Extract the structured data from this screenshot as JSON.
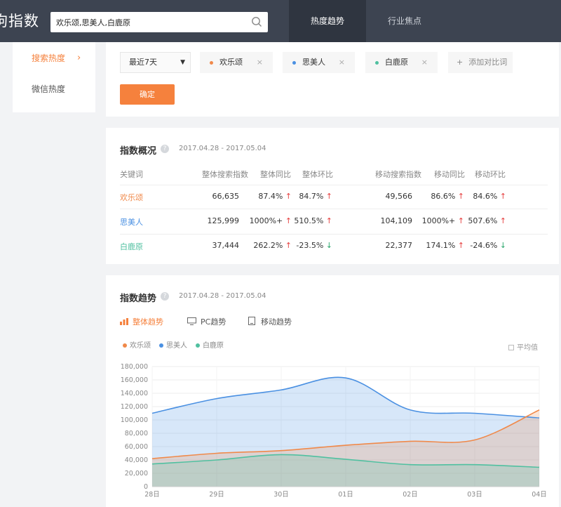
{
  "header": {
    "logo": "狗指数",
    "search_value": "欢乐颂,思美人,白鹿原",
    "tabs": [
      {
        "label": "热度趋势",
        "active": true
      },
      {
        "label": "行业焦点",
        "active": false
      }
    ]
  },
  "sidebar": {
    "items": [
      {
        "label": "搜索热度",
        "active": true
      },
      {
        "label": "微信热度",
        "active": false
      }
    ]
  },
  "filter": {
    "period": "最近7天",
    "keywords": [
      {
        "label": "欢乐颂",
        "color": "#f0894a"
      },
      {
        "label": "思美人",
        "color": "#4a90e2"
      },
      {
        "label": "白鹿原",
        "color": "#50c0a0"
      }
    ],
    "close_glyph": "×",
    "add_label": "添加对比词",
    "confirm_label": "确定"
  },
  "overview": {
    "title": "指数概况",
    "date_range": "2017.04.28 - 2017.05.04",
    "headers": [
      "关键词",
      "整体搜索指数",
      "整体同比",
      "整体环比",
      "移动搜索指数",
      "移动同比",
      "移动环比"
    ],
    "rows": [
      {
        "keyword": "欢乐颂",
        "color": "#f0894a",
        "total": "66,635",
        "yoy": "87.4%",
        "yoy_dir": "up",
        "mom": "84.7%",
        "mom_dir": "up",
        "mobile": "49,566",
        "m_yoy": "86.6%",
        "m_yoy_dir": "up",
        "m_mom": "84.6%",
        "m_mom_dir": "up"
      },
      {
        "keyword": "思美人",
        "color": "#4a90e2",
        "total": "125,999",
        "yoy": "1000%+",
        "yoy_dir": "up",
        "mom": "510.5%",
        "mom_dir": "up",
        "mobile": "104,109",
        "m_yoy": "1000%+",
        "m_yoy_dir": "up",
        "m_mom": "507.6%",
        "m_mom_dir": "up"
      },
      {
        "keyword": "白鹿原",
        "color": "#50c0a0",
        "total": "37,444",
        "yoy": "262.2%",
        "yoy_dir": "up",
        "mom": "-23.5%",
        "mom_dir": "down",
        "mobile": "22,377",
        "m_yoy": "174.1%",
        "m_yoy_dir": "up",
        "m_mom": "-24.6%",
        "m_mom_dir": "down"
      }
    ]
  },
  "trend": {
    "title": "指数趋势",
    "date_range": "2017.04.28 - 2017.05.04",
    "tabs": [
      {
        "label": "整体趋势",
        "active": true
      },
      {
        "label": "PC趋势",
        "active": false
      },
      {
        "label": "移动趋势",
        "active": false
      }
    ],
    "avg_label": "平均值"
  },
  "chart_data": {
    "type": "area",
    "categories": [
      "28日",
      "29日",
      "30日",
      "01日",
      "02日",
      "03日",
      "04日"
    ],
    "series": [
      {
        "name": "欢乐颂",
        "color": "#f0894a",
        "values": [
          42000,
          50000,
          54000,
          62000,
          68000,
          70000,
          115000
        ]
      },
      {
        "name": "思美人",
        "color": "#4a90e2",
        "values": [
          110000,
          132000,
          145000,
          163000,
          115000,
          110000,
          103000
        ]
      },
      {
        "name": "白鹿原",
        "color": "#50c0a0",
        "values": [
          34000,
          40000,
          48000,
          41000,
          33000,
          33000,
          29000
        ]
      }
    ],
    "y_ticks": [
      "0",
      "20,000",
      "40,000",
      "60,000",
      "80,000",
      "100,000",
      "120,000",
      "140,000",
      "160,000",
      "180,000"
    ],
    "ylim": [
      0,
      180000
    ],
    "grid": true,
    "legend": "top-left"
  }
}
